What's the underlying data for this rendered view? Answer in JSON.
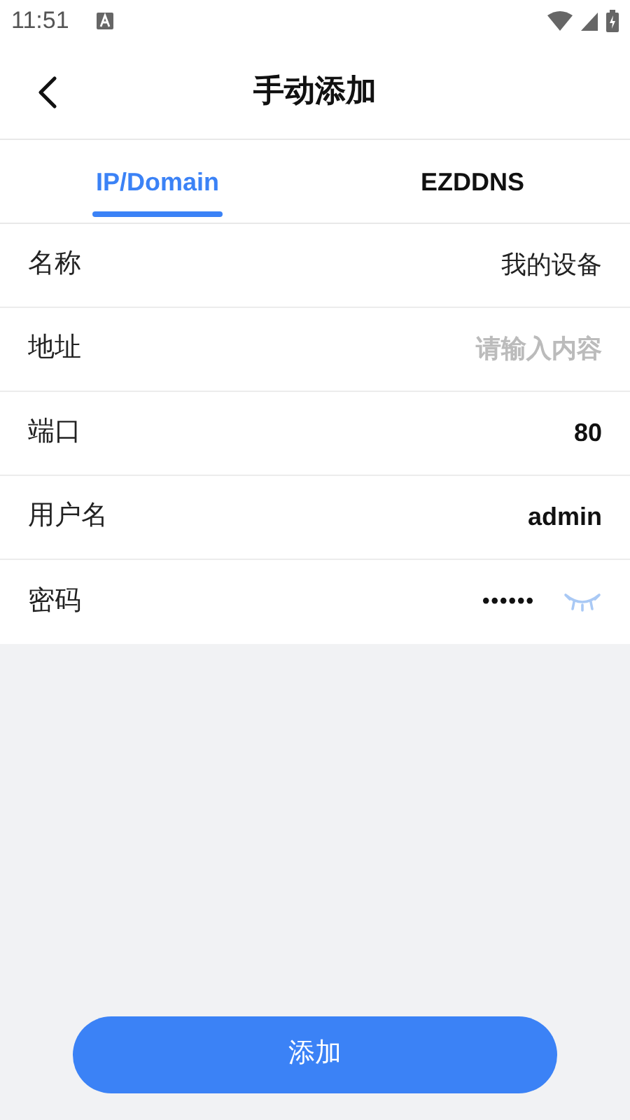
{
  "status_bar": {
    "time": "11:51"
  },
  "header": {
    "title": "手动添加"
  },
  "tabs": [
    {
      "label": "IP/Domain",
      "selected": true
    },
    {
      "label": "EZDDNS",
      "selected": false
    }
  ],
  "fields": [
    {
      "kind": "text",
      "label": "名称",
      "value": "我的设备"
    },
    {
      "kind": "text",
      "label": "地址",
      "placeholder": "请输入内容"
    },
    {
      "kind": "text",
      "label": "端口",
      "value": "80"
    },
    {
      "kind": "text",
      "label": "用户名",
      "value": "admin"
    },
    {
      "kind": "password",
      "label": "密码",
      "value": "••••••"
    }
  ],
  "submit_button": {
    "label": "添加"
  }
}
